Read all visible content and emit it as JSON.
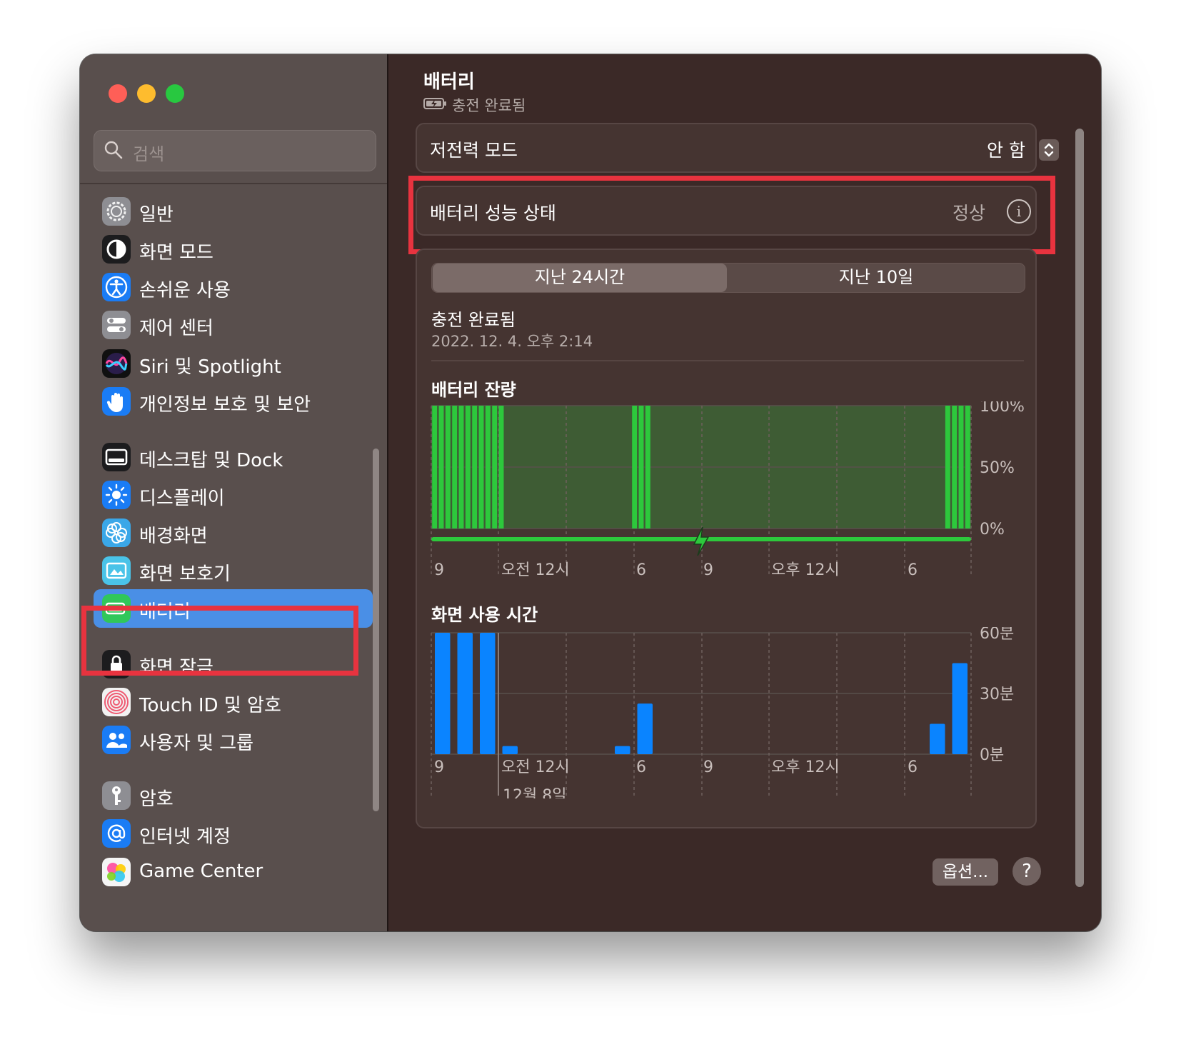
{
  "sidebar": {
    "search_placeholder": "검색",
    "items": [
      {
        "label": "일반",
        "icon": "gear-icon"
      },
      {
        "label": "화면 모드",
        "icon": "appearance-icon"
      },
      {
        "label": "손쉬운 사용",
        "icon": "accessibility-icon"
      },
      {
        "label": "제어 센터",
        "icon": "control-center-icon"
      },
      {
        "label": "Siri 및 Spotlight",
        "icon": "siri-icon"
      },
      {
        "label": "개인정보 보호 및 보안",
        "icon": "hand-icon"
      },
      {
        "label": "데스크탑 및 Dock",
        "icon": "dock-icon"
      },
      {
        "label": "디스플레이",
        "icon": "sun-icon"
      },
      {
        "label": "배경화면",
        "icon": "flower-icon"
      },
      {
        "label": "화면 보호기",
        "icon": "screensaver-icon"
      },
      {
        "label": "배터리",
        "icon": "battery-icon",
        "selected": true
      },
      {
        "label": "화면 잠금",
        "icon": "lock-icon"
      },
      {
        "label": "Touch ID 및 암호",
        "icon": "fingerprint-icon"
      },
      {
        "label": "사용자 및 그룹",
        "icon": "users-icon"
      },
      {
        "label": "암호",
        "icon": "key-icon"
      },
      {
        "label": "인터넷 계정",
        "icon": "at-icon"
      },
      {
        "label": "Game Center",
        "icon": "game-center-icon"
      }
    ]
  },
  "header": {
    "title": "배터리",
    "subtitle": "충전 완료됨"
  },
  "low_power": {
    "label": "저전력 모드",
    "value": "안 함"
  },
  "health": {
    "label": "배터리 성능 상태",
    "value": "정상"
  },
  "tabs": {
    "last24": "지난 24시간",
    "last10": "지난 10일"
  },
  "status": {
    "label": "충전 완료됨",
    "date": "2022. 12. 4. 오후 2:14"
  },
  "chart_data": [
    {
      "type": "bar",
      "title": "배터리 잔량",
      "y_ticks": [
        "100%",
        "50%",
        "0%"
      ],
      "ylim": [
        0,
        100
      ],
      "x_ticks": [
        "9",
        "오전 12시",
        "6",
        "9",
        "오후 12시",
        "6"
      ],
      "values": [
        100,
        100,
        100,
        100,
        100,
        100,
        100,
        100,
        100,
        100,
        100,
        0,
        0,
        0,
        0,
        0,
        0,
        0,
        0,
        0,
        0,
        0,
        0,
        0,
        0,
        0,
        0,
        0,
        0,
        0,
        100,
        100,
        100,
        0,
        0,
        0,
        0,
        0,
        0,
        0,
        0,
        0,
        0,
        0,
        0,
        0,
        0,
        0,
        0,
        0,
        0,
        0,
        0,
        0,
        0,
        0,
        0,
        0,
        0,
        0,
        0,
        0,
        0,
        0,
        0,
        0,
        0,
        0,
        0,
        0,
        0,
        0,
        0,
        0,
        0,
        0,
        0,
        100,
        100,
        100,
        100
      ],
      "background_level": 100,
      "charging_indicator": "full-range",
      "colors": {
        "bar": "#2dc83c",
        "background": "#3e5c34",
        "charging": "#2dc83c"
      }
    },
    {
      "type": "bar",
      "title": "화면 사용 시간",
      "y_ticks": [
        "60분",
        "30분",
        "0분"
      ],
      "ylim": [
        0,
        60
      ],
      "x_ticks": [
        "9",
        "오전 12시",
        "6",
        "9",
        "오후 12시",
        "6"
      ],
      "date_label": "12월 8일",
      "values": [
        60,
        60,
        60,
        4,
        0,
        0,
        0,
        0,
        4,
        25,
        0,
        0,
        0,
        0,
        0,
        0,
        0,
        0,
        0,
        0,
        0,
        0,
        15,
        45
      ],
      "colors": {
        "bar": "#0a84ff"
      }
    }
  ],
  "buttons": {
    "options": "옵션...",
    "help": "?"
  }
}
